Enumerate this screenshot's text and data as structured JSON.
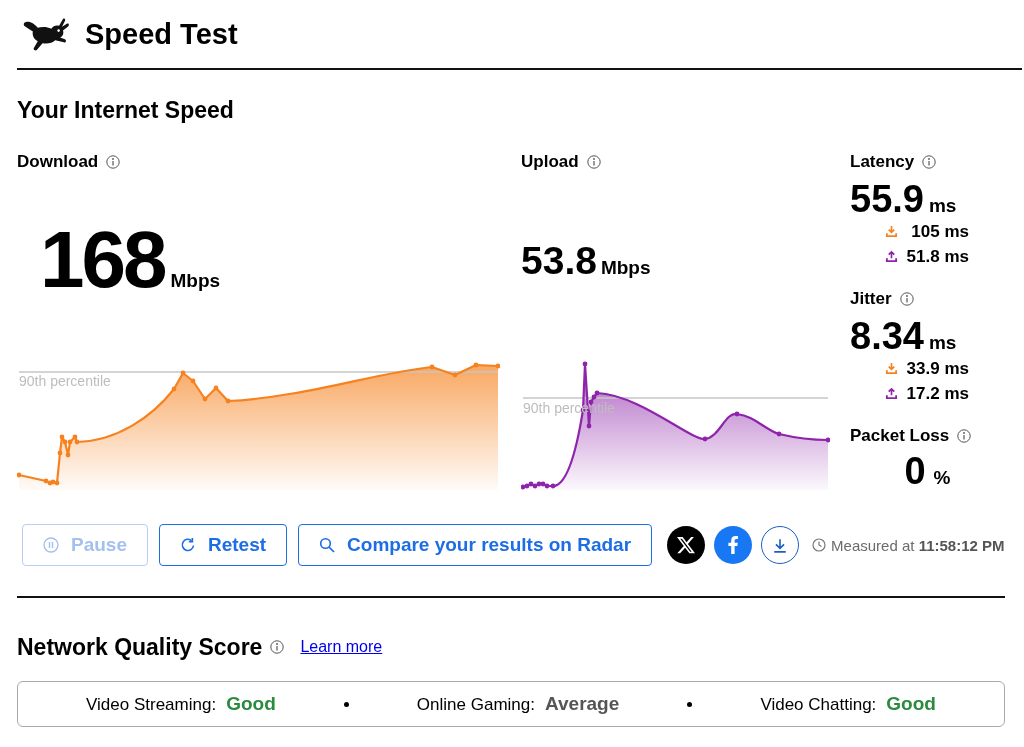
{
  "header": {
    "title": "Speed Test"
  },
  "speed": {
    "title": "Your Internet Speed",
    "download": {
      "label": "Download",
      "value": "168",
      "unit": "Mbps",
      "percentile_label": "90th percentile"
    },
    "upload": {
      "label": "Upload",
      "value": "53.8",
      "unit": "Mbps",
      "percentile_label": "90th percentile"
    },
    "stats": [
      {
        "kind": "timing",
        "label": "Latency",
        "value": "55.9",
        "unit": "ms",
        "details": [
          {
            "kind": "download",
            "value": "105 ms"
          },
          {
            "kind": "upload",
            "value": "51.8 ms"
          }
        ]
      },
      {
        "kind": "timing",
        "label": "Jitter",
        "value": "8.34",
        "unit": "ms",
        "details": [
          {
            "kind": "download",
            "value": "33.9 ms"
          },
          {
            "kind": "upload",
            "value": "17.2 ms"
          }
        ]
      },
      {
        "kind": "loss",
        "label": "Packet Loss",
        "value": "0",
        "unit": "%"
      }
    ]
  },
  "actions": [
    {
      "kind": "pause",
      "label": "Pause",
      "disabled": true
    },
    {
      "kind": "retest",
      "label": "Retest",
      "disabled": false
    },
    {
      "kind": "search",
      "label": "Compare your results on Radar",
      "disabled": false
    }
  ],
  "share": [
    {
      "kind": "x"
    },
    {
      "kind": "facebook"
    },
    {
      "kind": "download"
    }
  ],
  "measured": "Measured at **11:58:12 PM**",
  "network_quality": {
    "title": "Network Quality Score",
    "link": "Learn more",
    "items": [
      {
        "label": "Video Streaming:",
        "rating": "Good",
        "color": "#2a8a3e"
      },
      {
        "label": "Online Gaming:",
        "rating": "Average",
        "color": "#555555"
      },
      {
        "label": "Video Chatting:",
        "rating": "Good",
        "color": "#2a8a3e"
      }
    ]
  }
}
